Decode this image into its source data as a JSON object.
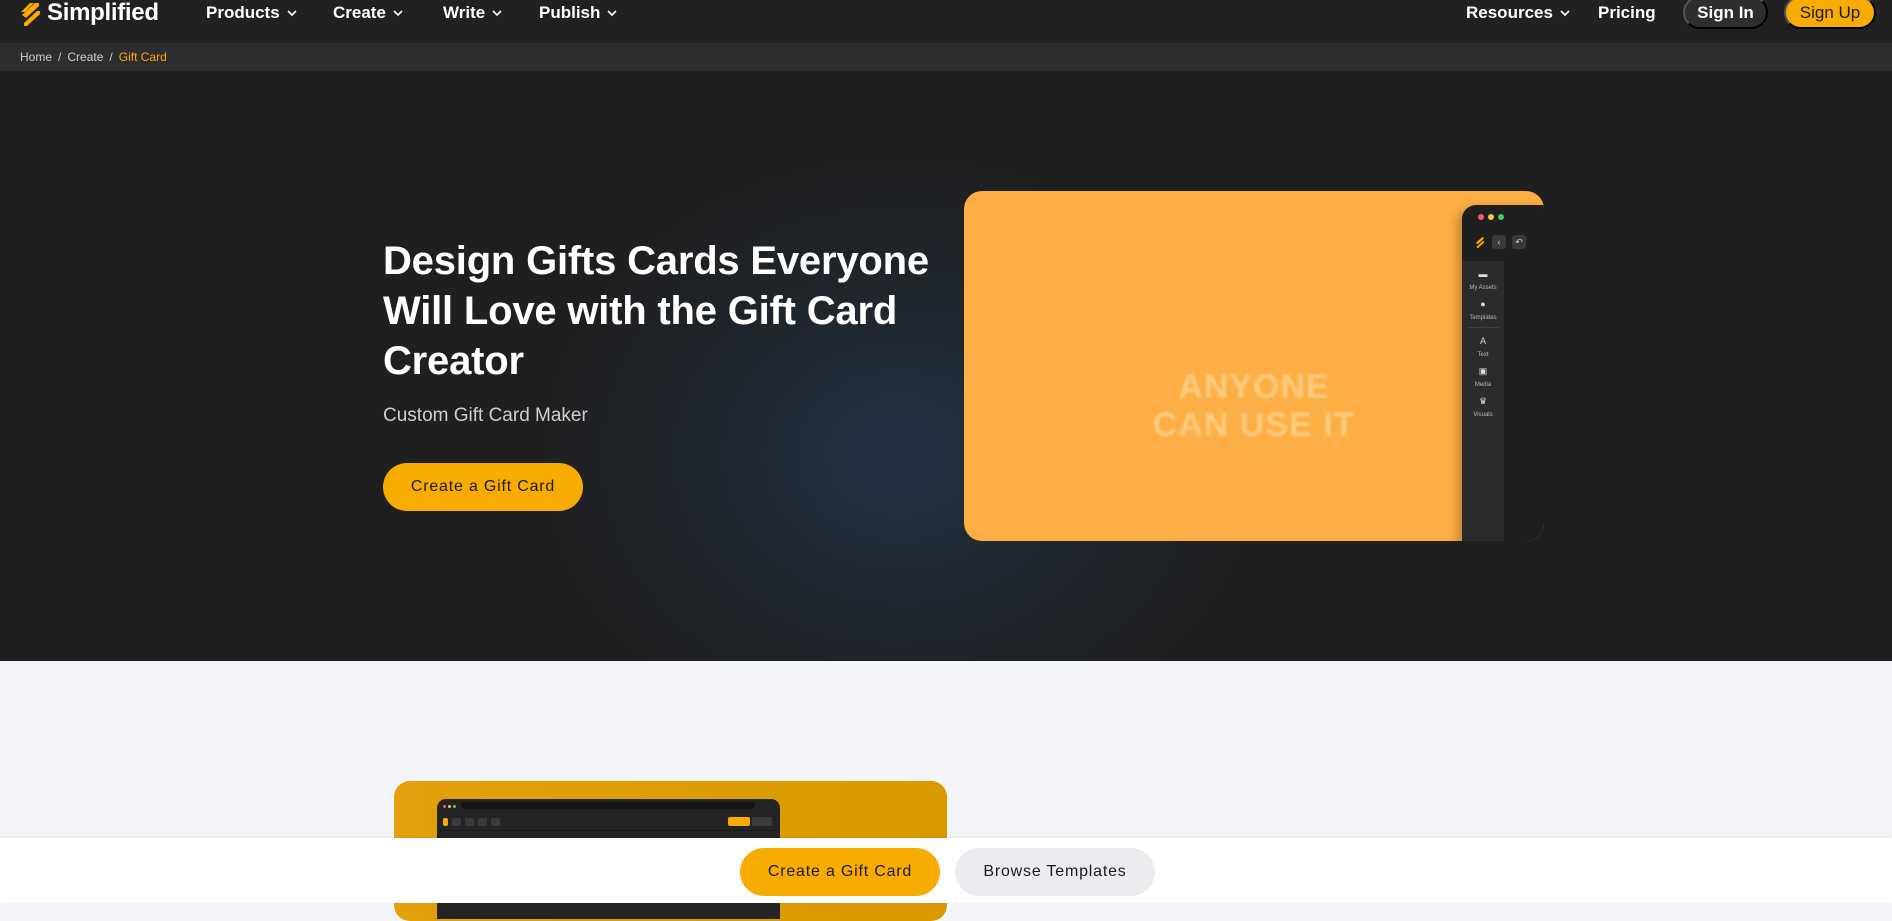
{
  "brand": {
    "name": "Simplified",
    "accent": "#f8ab00"
  },
  "nav": {
    "items": [
      {
        "label": "Products",
        "has_dropdown": true
      },
      {
        "label": "Create",
        "has_dropdown": true
      },
      {
        "label": "Write",
        "has_dropdown": true
      },
      {
        "label": "Publish",
        "has_dropdown": true
      }
    ],
    "right": {
      "resources": {
        "label": "Resources",
        "has_dropdown": true
      },
      "pricing": "Pricing",
      "sign_in": "Sign In",
      "sign_up": "Sign Up"
    }
  },
  "breadcrumb": {
    "items": [
      "Home",
      "Create",
      "Gift Card"
    ],
    "separator": "/"
  },
  "hero": {
    "title": "Design Gifts Cards Everyone Will Love with the Gift Card Creator",
    "subtitle": "Custom Gift Card Maker",
    "cta": "Create a Gift Card",
    "preview": {
      "overlay_text": "ANYONE CAN USE IT",
      "bg_color": "#fdae44",
      "sidebar_items": [
        "My Assets",
        "Templates",
        "Text",
        "Media",
        "Visuals"
      ]
    }
  },
  "sticky_bar": {
    "primary_cta": "Create a Gift Card",
    "secondary_cta": "Browse Templates"
  }
}
